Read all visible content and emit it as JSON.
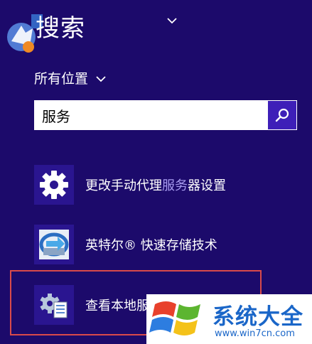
{
  "header": {
    "title": "搜索",
    "scope_label": "所有位置"
  },
  "search": {
    "query": "服务"
  },
  "results": [
    {
      "label_pre": "更改手动代理",
      "label_hl": "服务",
      "label_post": "器设置",
      "icon": "gear-icon"
    },
    {
      "label_pre": "英特尔® 快速存储技术",
      "label_hl": "",
      "label_post": "",
      "icon": "intel-rst-icon"
    },
    {
      "label_pre": "查看本地服",
      "label_hl": "",
      "label_post": "",
      "icon": "services-icon"
    }
  ],
  "watermark": {
    "brand": "系统大全",
    "url": "www.win7cn.com"
  },
  "colors": {
    "background": "#1c0a6b",
    "accent": "#3e1fb8",
    "highlight_border": "#d94a4a",
    "match_text": "#a89cf0",
    "watermark_blue": "#1a66c8"
  }
}
